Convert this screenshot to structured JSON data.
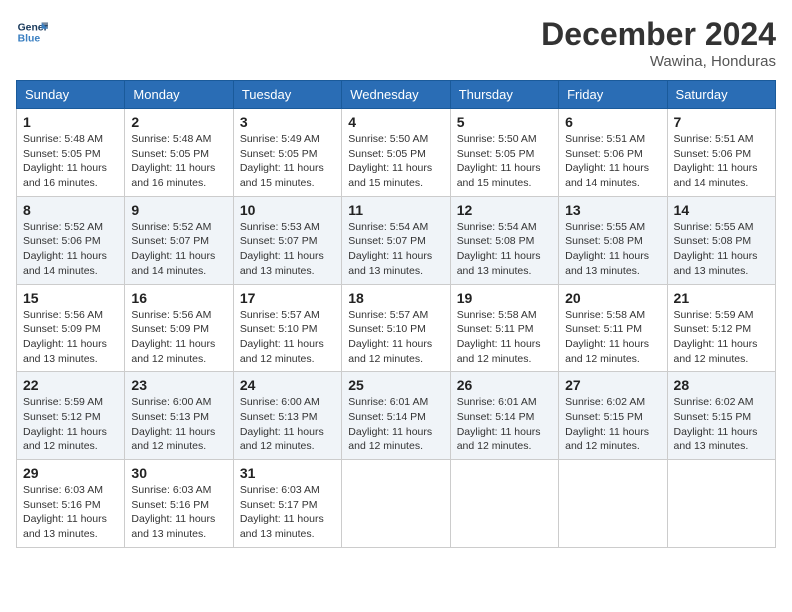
{
  "logo": {
    "line1": "General",
    "line2": "Blue"
  },
  "title": "December 2024",
  "location": "Wawina, Honduras",
  "days_of_week": [
    "Sunday",
    "Monday",
    "Tuesday",
    "Wednesday",
    "Thursday",
    "Friday",
    "Saturday"
  ],
  "weeks": [
    [
      {
        "day": "1",
        "info": "Sunrise: 5:48 AM\nSunset: 5:05 PM\nDaylight: 11 hours and 16 minutes."
      },
      {
        "day": "2",
        "info": "Sunrise: 5:48 AM\nSunset: 5:05 PM\nDaylight: 11 hours and 16 minutes."
      },
      {
        "day": "3",
        "info": "Sunrise: 5:49 AM\nSunset: 5:05 PM\nDaylight: 11 hours and 15 minutes."
      },
      {
        "day": "4",
        "info": "Sunrise: 5:50 AM\nSunset: 5:05 PM\nDaylight: 11 hours and 15 minutes."
      },
      {
        "day": "5",
        "info": "Sunrise: 5:50 AM\nSunset: 5:05 PM\nDaylight: 11 hours and 15 minutes."
      },
      {
        "day": "6",
        "info": "Sunrise: 5:51 AM\nSunset: 5:06 PM\nDaylight: 11 hours and 14 minutes."
      },
      {
        "day": "7",
        "info": "Sunrise: 5:51 AM\nSunset: 5:06 PM\nDaylight: 11 hours and 14 minutes."
      }
    ],
    [
      {
        "day": "8",
        "info": "Sunrise: 5:52 AM\nSunset: 5:06 PM\nDaylight: 11 hours and 14 minutes."
      },
      {
        "day": "9",
        "info": "Sunrise: 5:52 AM\nSunset: 5:07 PM\nDaylight: 11 hours and 14 minutes."
      },
      {
        "day": "10",
        "info": "Sunrise: 5:53 AM\nSunset: 5:07 PM\nDaylight: 11 hours and 13 minutes."
      },
      {
        "day": "11",
        "info": "Sunrise: 5:54 AM\nSunset: 5:07 PM\nDaylight: 11 hours and 13 minutes."
      },
      {
        "day": "12",
        "info": "Sunrise: 5:54 AM\nSunset: 5:08 PM\nDaylight: 11 hours and 13 minutes."
      },
      {
        "day": "13",
        "info": "Sunrise: 5:55 AM\nSunset: 5:08 PM\nDaylight: 11 hours and 13 minutes."
      },
      {
        "day": "14",
        "info": "Sunrise: 5:55 AM\nSunset: 5:08 PM\nDaylight: 11 hours and 13 minutes."
      }
    ],
    [
      {
        "day": "15",
        "info": "Sunrise: 5:56 AM\nSunset: 5:09 PM\nDaylight: 11 hours and 13 minutes."
      },
      {
        "day": "16",
        "info": "Sunrise: 5:56 AM\nSunset: 5:09 PM\nDaylight: 11 hours and 12 minutes."
      },
      {
        "day": "17",
        "info": "Sunrise: 5:57 AM\nSunset: 5:10 PM\nDaylight: 11 hours and 12 minutes."
      },
      {
        "day": "18",
        "info": "Sunrise: 5:57 AM\nSunset: 5:10 PM\nDaylight: 11 hours and 12 minutes."
      },
      {
        "day": "19",
        "info": "Sunrise: 5:58 AM\nSunset: 5:11 PM\nDaylight: 11 hours and 12 minutes."
      },
      {
        "day": "20",
        "info": "Sunrise: 5:58 AM\nSunset: 5:11 PM\nDaylight: 11 hours and 12 minutes."
      },
      {
        "day": "21",
        "info": "Sunrise: 5:59 AM\nSunset: 5:12 PM\nDaylight: 11 hours and 12 minutes."
      }
    ],
    [
      {
        "day": "22",
        "info": "Sunrise: 5:59 AM\nSunset: 5:12 PM\nDaylight: 11 hours and 12 minutes."
      },
      {
        "day": "23",
        "info": "Sunrise: 6:00 AM\nSunset: 5:13 PM\nDaylight: 11 hours and 12 minutes."
      },
      {
        "day": "24",
        "info": "Sunrise: 6:00 AM\nSunset: 5:13 PM\nDaylight: 11 hours and 12 minutes."
      },
      {
        "day": "25",
        "info": "Sunrise: 6:01 AM\nSunset: 5:14 PM\nDaylight: 11 hours and 12 minutes."
      },
      {
        "day": "26",
        "info": "Sunrise: 6:01 AM\nSunset: 5:14 PM\nDaylight: 11 hours and 12 minutes."
      },
      {
        "day": "27",
        "info": "Sunrise: 6:02 AM\nSunset: 5:15 PM\nDaylight: 11 hours and 12 minutes."
      },
      {
        "day": "28",
        "info": "Sunrise: 6:02 AM\nSunset: 5:15 PM\nDaylight: 11 hours and 13 minutes."
      }
    ],
    [
      {
        "day": "29",
        "info": "Sunrise: 6:03 AM\nSunset: 5:16 PM\nDaylight: 11 hours and 13 minutes."
      },
      {
        "day": "30",
        "info": "Sunrise: 6:03 AM\nSunset: 5:16 PM\nDaylight: 11 hours and 13 minutes."
      },
      {
        "day": "31",
        "info": "Sunrise: 6:03 AM\nSunset: 5:17 PM\nDaylight: 11 hours and 13 minutes."
      },
      null,
      null,
      null,
      null
    ]
  ]
}
